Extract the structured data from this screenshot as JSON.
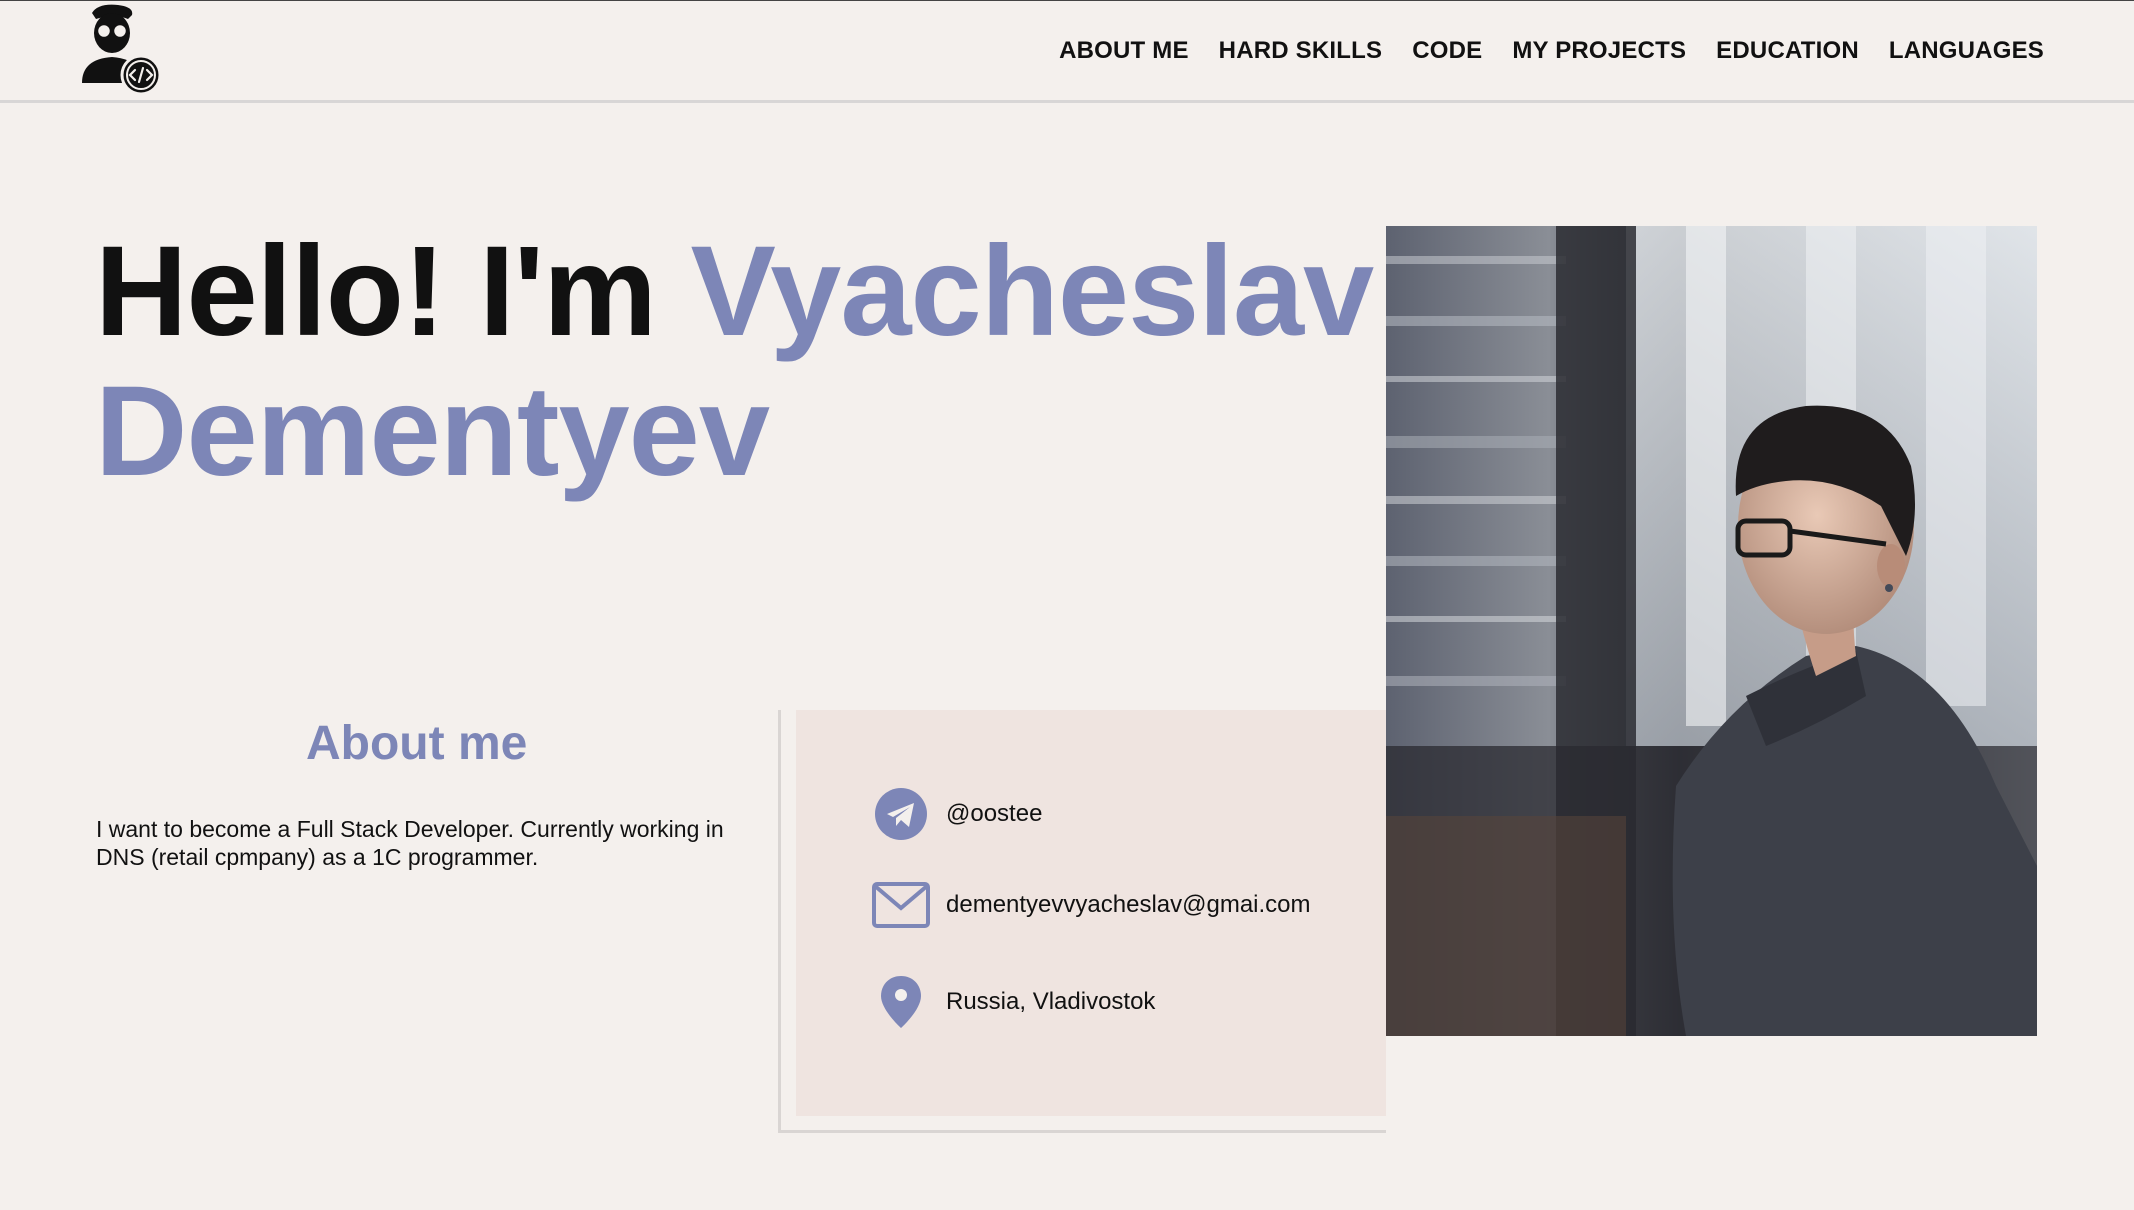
{
  "nav": {
    "items": [
      "ABOUT ME",
      "HARD SKILLS",
      "CODE",
      "MY PROJECTS",
      "EDUCATION",
      "LANGUAGES"
    ]
  },
  "hero": {
    "greeting": "Hello! I'm",
    "first_name": "Vyacheslav",
    "last_name": "Dementyev"
  },
  "about": {
    "heading": "About me",
    "text": "I want to become a Full Stack Developer. Currently working in DNS (retail cpmpany) as a 1C programmer."
  },
  "contacts": {
    "telegram": "@oostee",
    "email": "dementyevvyacheslav@gmai.com",
    "location": "Russia, Vladivostok"
  },
  "icons": {
    "logo": "developer-avatar-icon",
    "telegram": "telegram-icon",
    "email": "mail-icon",
    "location": "location-pin-icon"
  },
  "colors": {
    "background": "#f4f0ed",
    "accent": "#7d86b7",
    "card": "#efe4e0"
  }
}
